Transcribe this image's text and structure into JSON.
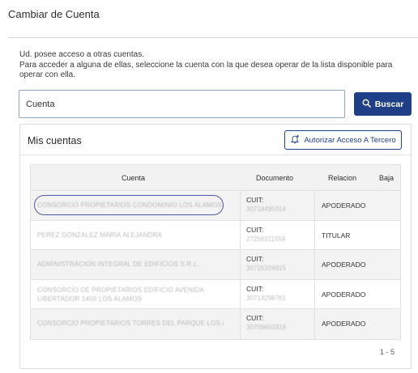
{
  "page": {
    "title": "Cambiar de Cuenta"
  },
  "intro": {
    "line1": "Ud. posee acceso a otras cuentas.",
    "line2": "Para acceder a alguna de ellas, seleccione la cuenta con la que desea operar de la lista disponible para operar con ella."
  },
  "search": {
    "value": "Cuenta",
    "placeholder": "Cuenta",
    "button_label": "Buscar"
  },
  "accounts": {
    "title": "Mis cuentas",
    "authorize_label": "Autorizar Acceso A Tercero",
    "columns": {
      "cuenta": "Cuenta",
      "documento": "Documento",
      "relacion": "Relacion",
      "baja": "Baja"
    },
    "rows": [
      {
        "cuenta": "CONSORCIO PROPIETARIOS CONDOMINIO LOS ALAMOS",
        "cuit_label": "CUIT:",
        "cuit": "30718495314",
        "relacion": "APODERADO"
      },
      {
        "cuenta": "PEREZ GONZALEZ MARIA ALEJANDRA",
        "cuit_label": "CUIT:",
        "cuit": "27256311559",
        "relacion": "TITULAR"
      },
      {
        "cuenta": "ADMINISTRACION INTEGRAL DE EDIFICIOS S.R.L.",
        "cuit_label": "CUIT:",
        "cuit": "30715324915",
        "relacion": "APODERADO"
      },
      {
        "cuenta": "CONSORCIO DE PROPIETARIOS EDIFICIO AVENIDA LIBERTADOR 1450 LOS ALAMOS",
        "cuit_label": "CUIT:",
        "cuit": "30713298761",
        "relacion": "APODERADO"
      },
      {
        "cuenta": "CONSORCIO PROPIETARIOS TORRES DEL PARQUE LOS ALAMOS",
        "cuit_label": "CUIT:",
        "cuit": "30709650316",
        "relacion": "APODERADO"
      }
    ],
    "pagination": "1 - 5"
  },
  "colors": {
    "primary": "#1f3f86",
    "highlight_ring": "#4a5ca8",
    "row_shade": "#f3f3f3"
  }
}
